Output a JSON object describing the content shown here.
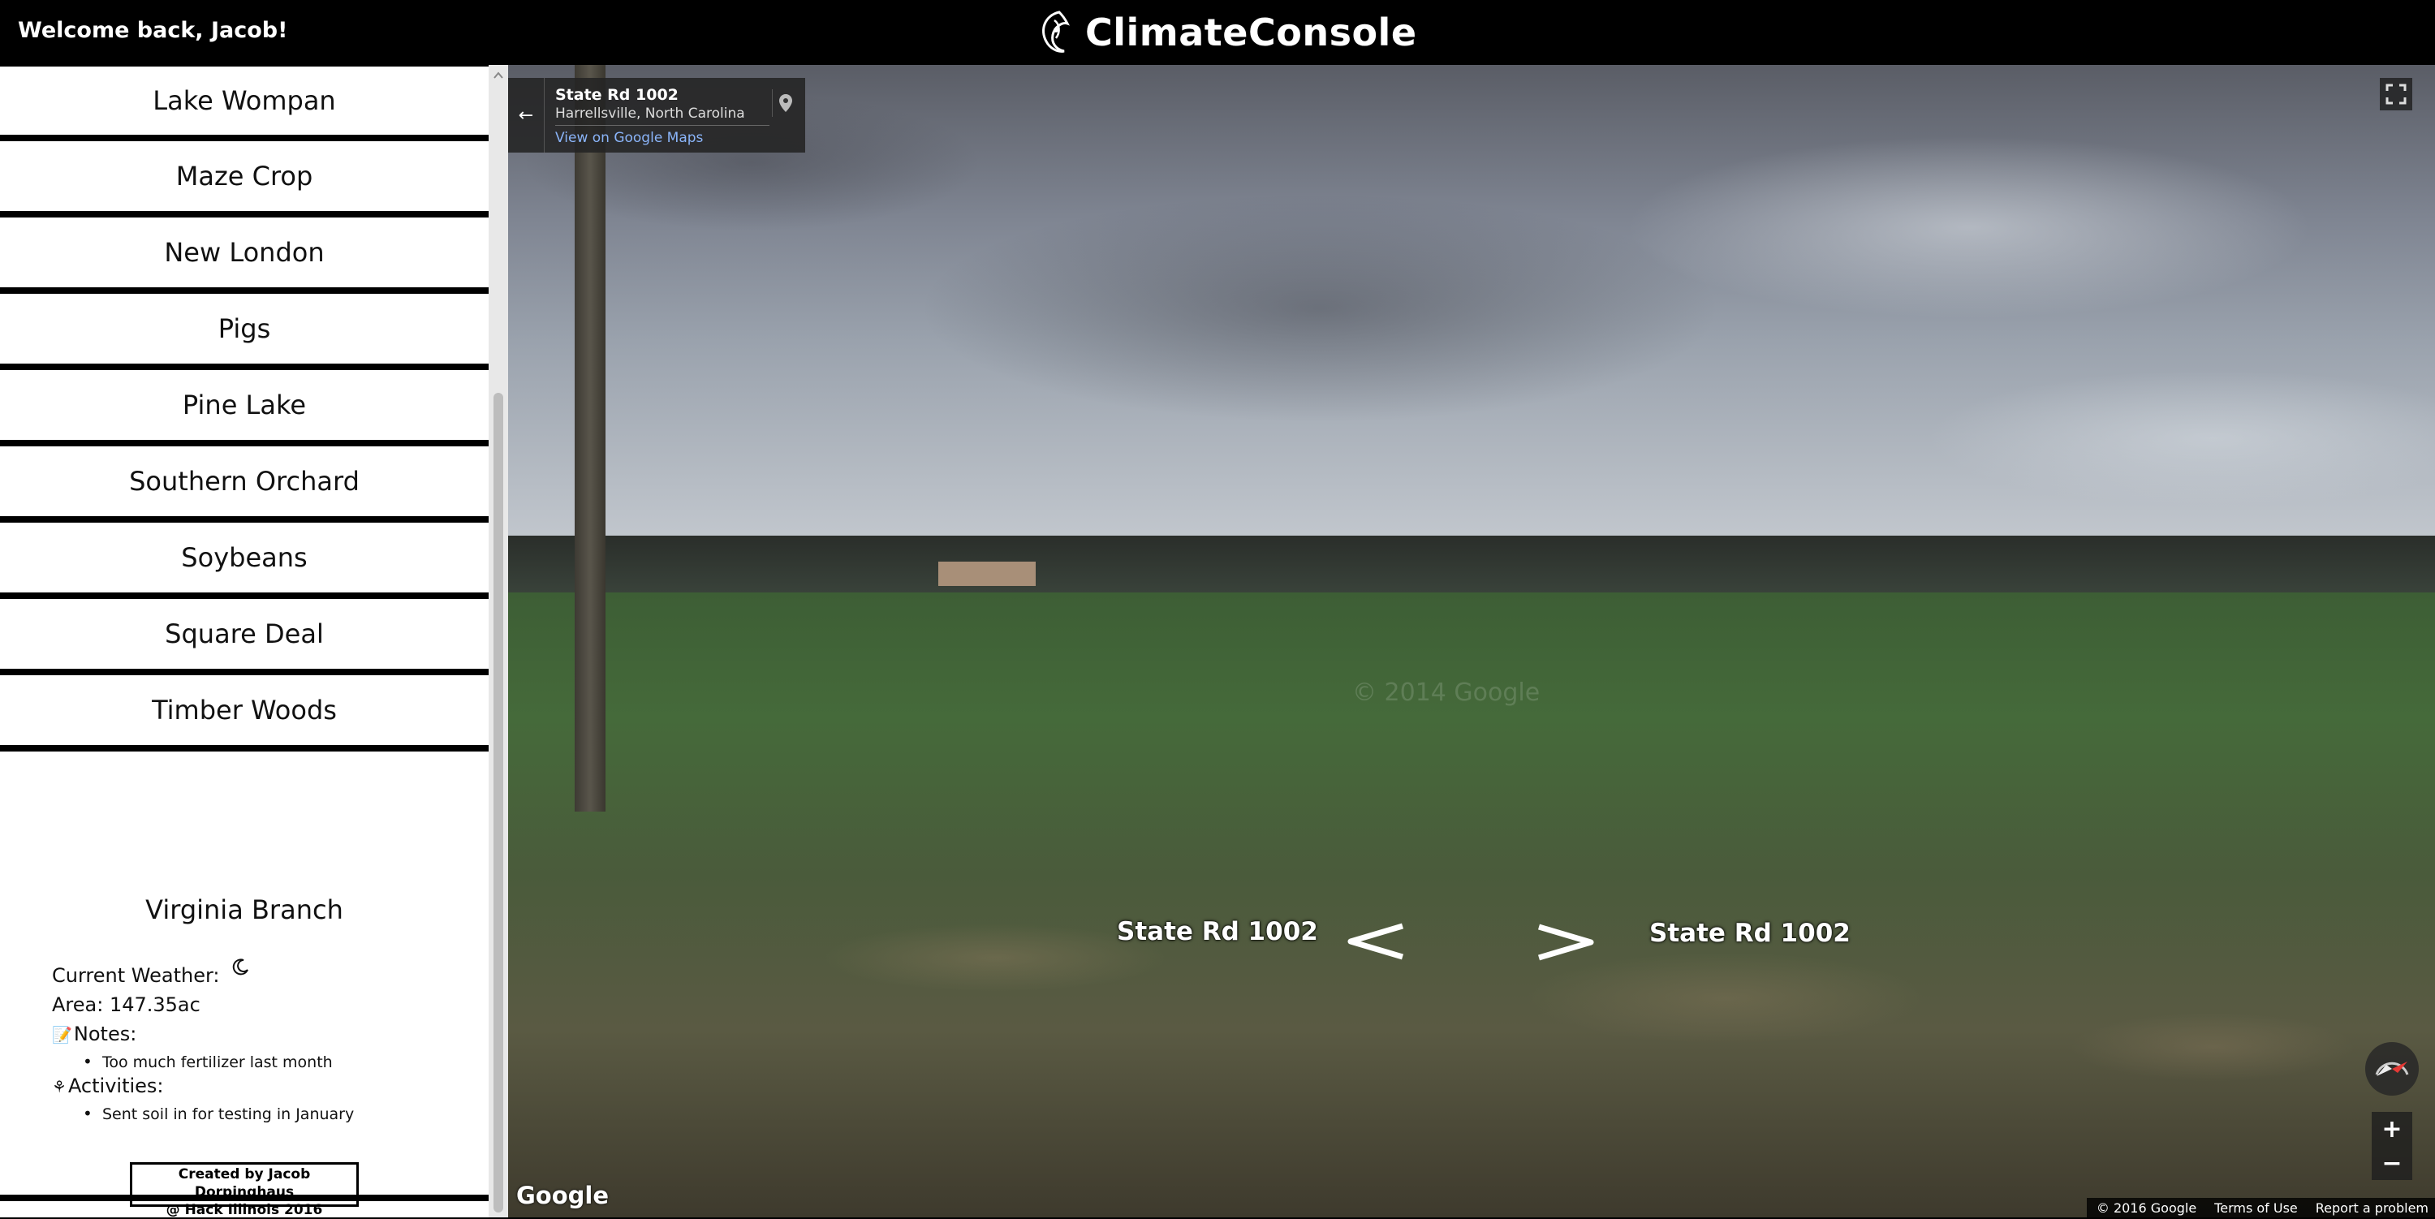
{
  "header": {
    "welcome": "Welcome back, Jacob!",
    "brand_name": "ClimateConsole"
  },
  "sidebar": {
    "farms": [
      {
        "label": "Lake Wompan"
      },
      {
        "label": "Maze Crop"
      },
      {
        "label": "New London"
      },
      {
        "label": "Pigs"
      },
      {
        "label": "Pine Lake"
      },
      {
        "label": "Southern Orchard"
      },
      {
        "label": "Soybeans"
      },
      {
        "label": "Square Deal"
      },
      {
        "label": "Timber Woods"
      }
    ],
    "selected": {
      "name": "Virginia Branch",
      "weather_label": "Current Weather:",
      "weather_icon": "moon-icon",
      "area": "Area: 147.35ac",
      "notes_label": "Notes:",
      "notes": [
        "Too much fertilizer last month"
      ],
      "activities_label": "Activities:",
      "activities": [
        "Sent soil in for testing in January"
      ]
    },
    "credit_line1": "Created by Jacob Dorpinghaus",
    "credit_line2": "@ Hack Illinois 2016"
  },
  "streetview": {
    "location_title": "State Rd 1002",
    "location_sub": "Harrellsville, North Carolina",
    "maps_link": "View on Google Maps",
    "left_label": "State Rd 1002",
    "right_label": "State Rd 1002",
    "google_logo": "Google",
    "watermark": "© 2014 Google",
    "footer": {
      "copyright": "© 2016 Google",
      "terms": "Terms of Use",
      "report": "Report a problem"
    },
    "zoom_in": "+",
    "zoom_out": "−"
  },
  "colors": {
    "header_bg": "#000000",
    "sidebar_bg": "#ffffff",
    "link": "#8ab4f8"
  }
}
